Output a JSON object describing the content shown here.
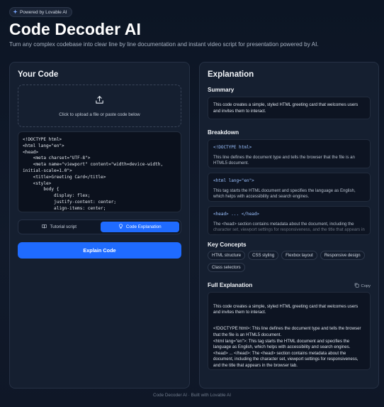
{
  "badge": {
    "label": "Powered by Lovable AI",
    "icon": "sparkle-icon"
  },
  "header": {
    "title": "Code Decoder AI",
    "subtitle": "Turn any complex codebase into clear line by line documentation and instant video script for presentation powered by AI."
  },
  "left": {
    "title": "Your Code",
    "upload_text": "Click to upload a file or paste code below",
    "code": "<!DOCTYPE html>\n<html lang=\"en\">\n<head>\n    <meta charset=\"UTF-8\">\n    <meta name=\"viewport\" content=\"width=device-width,\ninitial-scale=1.0\">\n    <title>Greeting Card</title>\n    <style>\n        body {\n            display: flex;\n            justify-content: center;\n            align-items: center;",
    "tabs": [
      {
        "label": "Tutorial script",
        "icon": "book-icon"
      },
      {
        "label": "Code Explanation",
        "icon": "lightbulb-icon"
      }
    ],
    "explain_label": "Explain Code"
  },
  "right": {
    "title": "Explanation",
    "summary_heading": "Summary",
    "summary": "This code creates a simple, styled HTML greeting card that welcomes users and invites them to interact.",
    "breakdown_heading": "Breakdown",
    "breakdown": [
      {
        "code": "<!DOCTYPE html>",
        "desc": "This line defines the document type and tells the browser that the file is an HTML5 document."
      },
      {
        "code": "<html lang=\"en\">",
        "desc": "This tag starts the HTML document and specifies the language as English, which helps with accessibility and search engines."
      },
      {
        "code": "<head> ... </head>",
        "desc": "The <head> section contains metadata about the document, including the character set, viewport settings for responsiveness, and the title that appears in the browser tab."
      }
    ],
    "concepts_heading": "Key Concepts",
    "concepts": [
      "HTML structure",
      "CSS styling",
      "Flexbox layout",
      "Responsive design",
      "Class selectors"
    ],
    "full_heading": "Full Explanation",
    "copy_label": "Copy",
    "full_text": [
      "This code creates a simple, styled HTML greeting card that welcomes users and invites them to interact.",
      "<!DOCTYPE html>: This line defines the document type and tells the browser that the file is an HTML5 document.\n<html lang=\"en\">: This tag starts the HTML document and specifies the language as English, which helps with accessibility and search engines.\n<head> ... </head>: The <head> section contains metadata about the document, including the character set, viewport settings for responsiveness, and the title that appears in the browser tab.\n<style> ... </style>: This section includes CSS styles that control the"
    ]
  },
  "footer": "Code Decoder AI · Built with Lovable AI",
  "colors": {
    "accent": "#1f6bff",
    "background": "#0c1524",
    "panel": "#151f30"
  }
}
